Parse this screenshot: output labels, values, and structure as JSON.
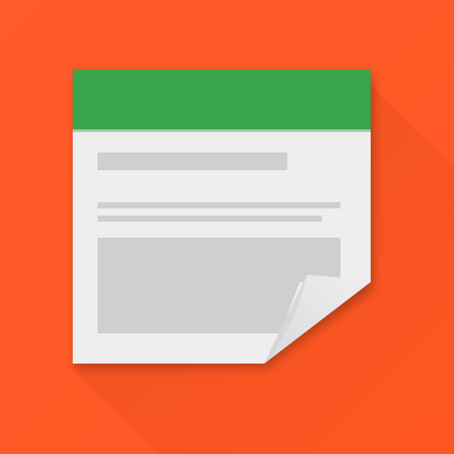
{
  "icon": {
    "name": "note-document-icon",
    "colors": {
      "background": "#ff5722",
      "header": "#3aa54a",
      "paper": "#eeeeee",
      "paper_edge": "#f6f6f6",
      "placeholder": "#cfcfcf",
      "fold": "#e3e3e3",
      "shadow": "#d84315"
    }
  }
}
